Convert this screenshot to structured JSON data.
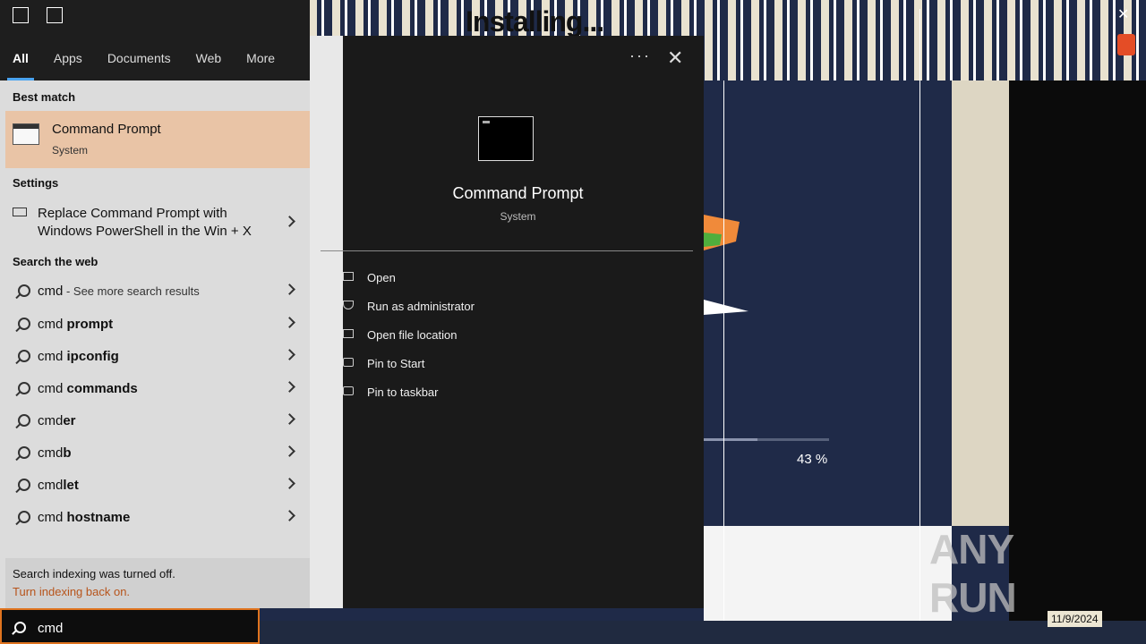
{
  "background": {
    "installer_title": "Installing...",
    "progress_percent": 43,
    "progress_text": "43 %",
    "close_glyph": "✕",
    "watermark": "ANY RUN",
    "tray_date": "11/9/2024"
  },
  "start_menu": {
    "tabs": [
      {
        "label": "All",
        "active": true
      },
      {
        "label": "Apps"
      },
      {
        "label": "Documents"
      },
      {
        "label": "Web"
      },
      {
        "label": "More"
      }
    ],
    "best_match": {
      "header": "Best match",
      "title": "Command Prompt",
      "subtitle": "System"
    },
    "settings": {
      "header": "Settings",
      "item_line1": "Replace Command Prompt with",
      "item_line2": "Windows PowerShell in the Win + X"
    },
    "web": {
      "header": "Search the web",
      "items": [
        {
          "prefix": "cmd",
          "suffix": " - See more search results"
        },
        {
          "prefix": "cmd ",
          "bold": "prompt"
        },
        {
          "prefix": "cmd ",
          "bold": "ipconfig"
        },
        {
          "prefix": "cmd ",
          "bold": "commands"
        },
        {
          "prefix": "cmd",
          "bold": "er"
        },
        {
          "prefix": "cmd",
          "bold": "b"
        },
        {
          "prefix": "cmd",
          "bold": "let"
        },
        {
          "prefix": "cmd ",
          "bold": "hostname"
        }
      ]
    },
    "indexing": {
      "text": "Search indexing was turned off.",
      "link": "Turn indexing back on."
    },
    "search": {
      "value": "cmd"
    }
  },
  "detail_pane": {
    "more_glyph": "···",
    "close_glyph": "✕",
    "app_title": "Command Prompt",
    "app_subtitle": "System",
    "actions": [
      {
        "label": "Open",
        "icon": "open-icon"
      },
      {
        "label": "Run as administrator",
        "icon": "shield-icon"
      },
      {
        "label": "Open file location",
        "icon": "file-location-icon"
      },
      {
        "label": "Pin to Start",
        "icon": "pin-icon"
      },
      {
        "label": "Pin to taskbar",
        "icon": "pin-icon"
      }
    ]
  },
  "colors": {
    "highlight": "#e9c4a6",
    "accent_tab": "#4aa3f0",
    "search_border": "#e0741f",
    "link": "#b7541b"
  }
}
